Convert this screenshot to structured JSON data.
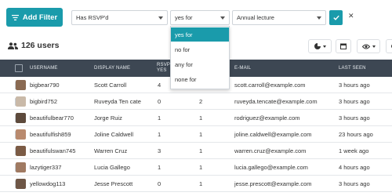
{
  "filter": {
    "add_label": "Add Filter",
    "field": "Has RSVP'd",
    "operator": "yes for",
    "value": "Annual lecture",
    "dropdown_options": [
      "yes for",
      "no for",
      "any for",
      "none for"
    ],
    "selected_option": "yes for"
  },
  "summary": {
    "count_label": "126 users"
  },
  "table": {
    "headers": [
      "USERNAME",
      "DISPLAY NAME",
      "RSVP YES",
      "",
      "E-MAIL",
      "LAST SEEN"
    ],
    "rows": [
      {
        "username": "bigbear790",
        "display": "Scott Carroll",
        "rsvp": "4",
        "count": "2",
        "email": "scott.carroll@example.com",
        "seen": "3 hours ago",
        "avatar": "#8a6a52"
      },
      {
        "username": "bigbird752",
        "display": "Ruveyda Ten cate",
        "rsvp": "0",
        "count": "2",
        "email": "ruveyda.tencate@example.com",
        "seen": "3 hours ago",
        "avatar": "#c9b9a8"
      },
      {
        "username": "beautifulbear770",
        "display": "Jorge Ruiz",
        "rsvp": "1",
        "count": "1",
        "email": "rodriguez@example.com",
        "seen": "3 hours ago",
        "avatar": "#5d4a3c"
      },
      {
        "username": "beautifulfish859",
        "display": "Joline Caldwell",
        "rsvp": "1",
        "count": "1",
        "email": "joline.caldwell@example.com",
        "seen": "23 hours ago",
        "avatar": "#b98a6e"
      },
      {
        "username": "beautifulswan745",
        "display": "Warren Cruz",
        "rsvp": "3",
        "count": "1",
        "email": "warren.cruz@example.com",
        "seen": "1 week ago",
        "avatar": "#7b5b45"
      },
      {
        "username": "lazytiger337",
        "display": "Lucia Gallego",
        "rsvp": "1",
        "count": "1",
        "email": "lucia.gallego@example.com",
        "seen": "4 hours ago",
        "avatar": "#a07a62"
      },
      {
        "username": "yellowdog113",
        "display": "Jesse Prescott",
        "rsvp": "0",
        "count": "1",
        "email": "jesse.prescott@example.com",
        "seen": "3 hours ago",
        "avatar": "#6e5646"
      }
    ]
  },
  "colors": {
    "accent": "#1a9bab",
    "header_bg": "#3d4753"
  }
}
